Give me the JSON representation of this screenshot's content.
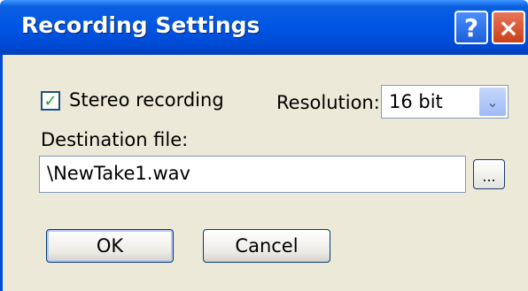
{
  "dialog": {
    "title": "Recording Settings",
    "help_glyph": "?",
    "close_glyph": "×"
  },
  "stereo": {
    "label": "Stereo recording",
    "checked": true,
    "check_glyph": "✓"
  },
  "resolution": {
    "label": "Resolution:",
    "value": "16 bit",
    "arrow_glyph": "⌄"
  },
  "destination": {
    "label": "Destination file:",
    "value": "\\NewTake1.wav",
    "browse_label": "..."
  },
  "buttons": {
    "ok": "OK",
    "cancel": "Cancel"
  }
}
